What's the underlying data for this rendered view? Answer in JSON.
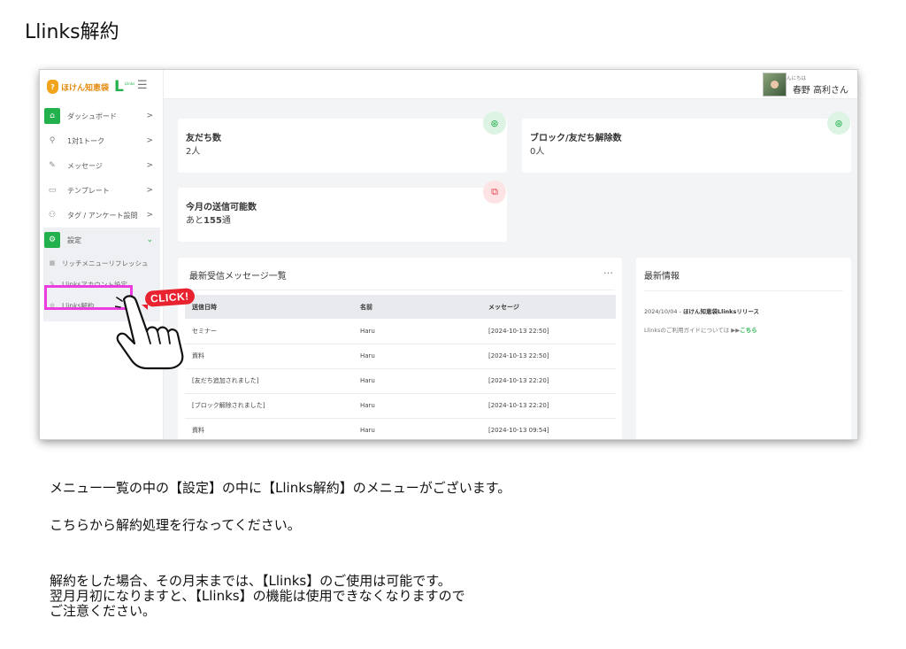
{
  "page_title": "Llinks解約",
  "app": {
    "brand_name": "ほけん知恵袋",
    "brand_logo": "L",
    "brand_logo_sub": "Llinks",
    "colors": {
      "accent": "#22b14c",
      "highlight": "#ec3ee0",
      "click_badge": "#e8232f"
    }
  },
  "sidebar": {
    "items": [
      {
        "icon": "home-icon",
        "glyph": "⌂",
        "label": "ダッシュボード",
        "chevron": ">"
      },
      {
        "icon": "user-icon",
        "glyph": "⚲",
        "label": "1対1トーク",
        "chevron": ">"
      },
      {
        "icon": "edit-icon",
        "glyph": "✎",
        "label": "メッセージ",
        "chevron": ">"
      },
      {
        "icon": "template-icon",
        "glyph": "▭",
        "label": "テンプレート",
        "chevron": ">"
      },
      {
        "icon": "users-icon",
        "glyph": "⚇",
        "label": "タグ / アンケート設問",
        "chevron": ">"
      },
      {
        "icon": "gear-icon",
        "glyph": "⚙",
        "label": "設定",
        "chevron": "⌄"
      }
    ],
    "settings_sub": [
      {
        "icon": "menu-grid-icon",
        "glyph": "▦",
        "label": "リッチメニューリフレッシュ"
      },
      {
        "icon": "edit-icon",
        "glyph": "✎",
        "label": "Llinksアカウント設定"
      },
      {
        "icon": "cancel-circle-icon",
        "glyph": "⊖",
        "label": "Llinks解約"
      }
    ]
  },
  "topbar": {
    "greeting": "こんにちは",
    "username": "春野 高利さん"
  },
  "cards": {
    "friends": {
      "label": "友だち数",
      "value": "2人",
      "icon": "user-circle-icon",
      "glyph": "⊛"
    },
    "blocked": {
      "label": "ブロック/友だち解除数",
      "value": "0人",
      "icon": "user-circle-icon",
      "glyph": "⊛"
    },
    "sendable": {
      "label": "今月の送信可能数",
      "value_prefix": "あと",
      "value_num": "155",
      "value_suffix": "通",
      "icon": "messages-icon",
      "glyph": "⧉"
    }
  },
  "messages": {
    "title": "最新受信メッセージ一覧",
    "menu": "…",
    "columns": [
      "送信日時",
      "名前",
      "メッセージ"
    ],
    "rows": [
      [
        "セミナー",
        "Haru",
        "[2024-10-13 22:50]"
      ],
      [
        "資料",
        "Haru",
        "[2024-10-13 22:50]"
      ],
      [
        "[友だち追加されました]",
        "Haru",
        "[2024-10-13 22:20]"
      ],
      [
        "[ブロック解除されました]",
        "Haru",
        "[2024-10-13 22:20]"
      ],
      [
        "資料",
        "Haru",
        "[2024-10-13 09:54]"
      ]
    ]
  },
  "news": {
    "title": "最新情報",
    "item1_date": "2024/10/04 - ",
    "item1_text": "ほけん知恵袋Llinksリリース",
    "item2_text": "Llinksのご利用ガイドについては ▶▶",
    "item2_link": "こちら"
  },
  "annotation": {
    "click_label": "CLICK!"
  },
  "instructions": {
    "line1": "メニュー一覧の中の【設定】の中に【Llinks解約】のメニューがございます。",
    "line2": "こちらから解約処理を行なってください。",
    "line3a": "解約をした場合、その月末までは、【Llinks】のご使用は可能です。",
    "line3b": "翌月月初になりますと、【Llinks】の機能は使用できなくなりますので",
    "line3c": "ご注意ください。"
  }
}
